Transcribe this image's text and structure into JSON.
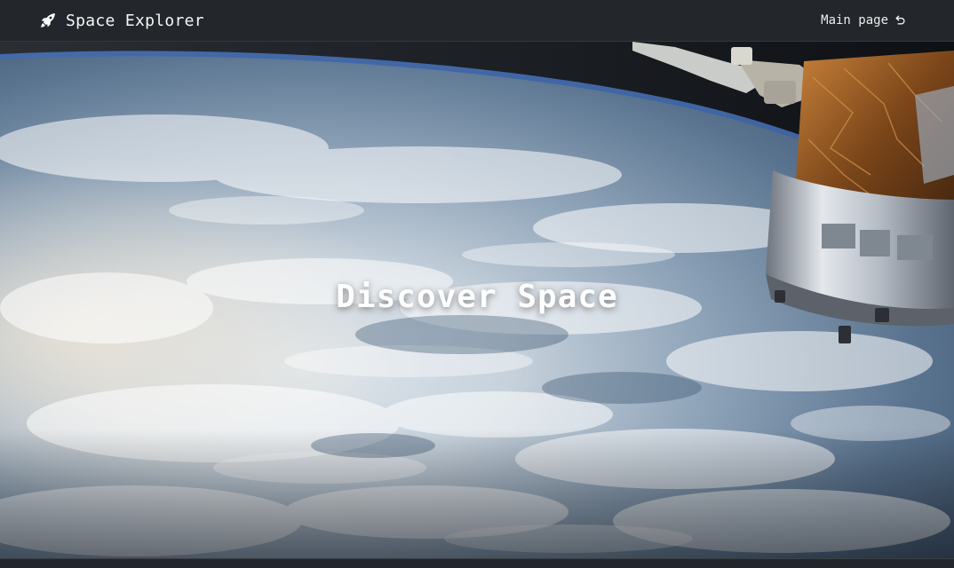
{
  "header": {
    "brand_title": "Space Explorer",
    "brand_icon": "rocket-icon",
    "nav_link_label": "Main page",
    "nav_link_icon": "return-arrow-icon"
  },
  "hero": {
    "title": "Discover Space",
    "image": "earth-from-orbit-with-space-station-module"
  },
  "colors": {
    "header_bg": "#23262b",
    "text": "#f2f2f2"
  }
}
